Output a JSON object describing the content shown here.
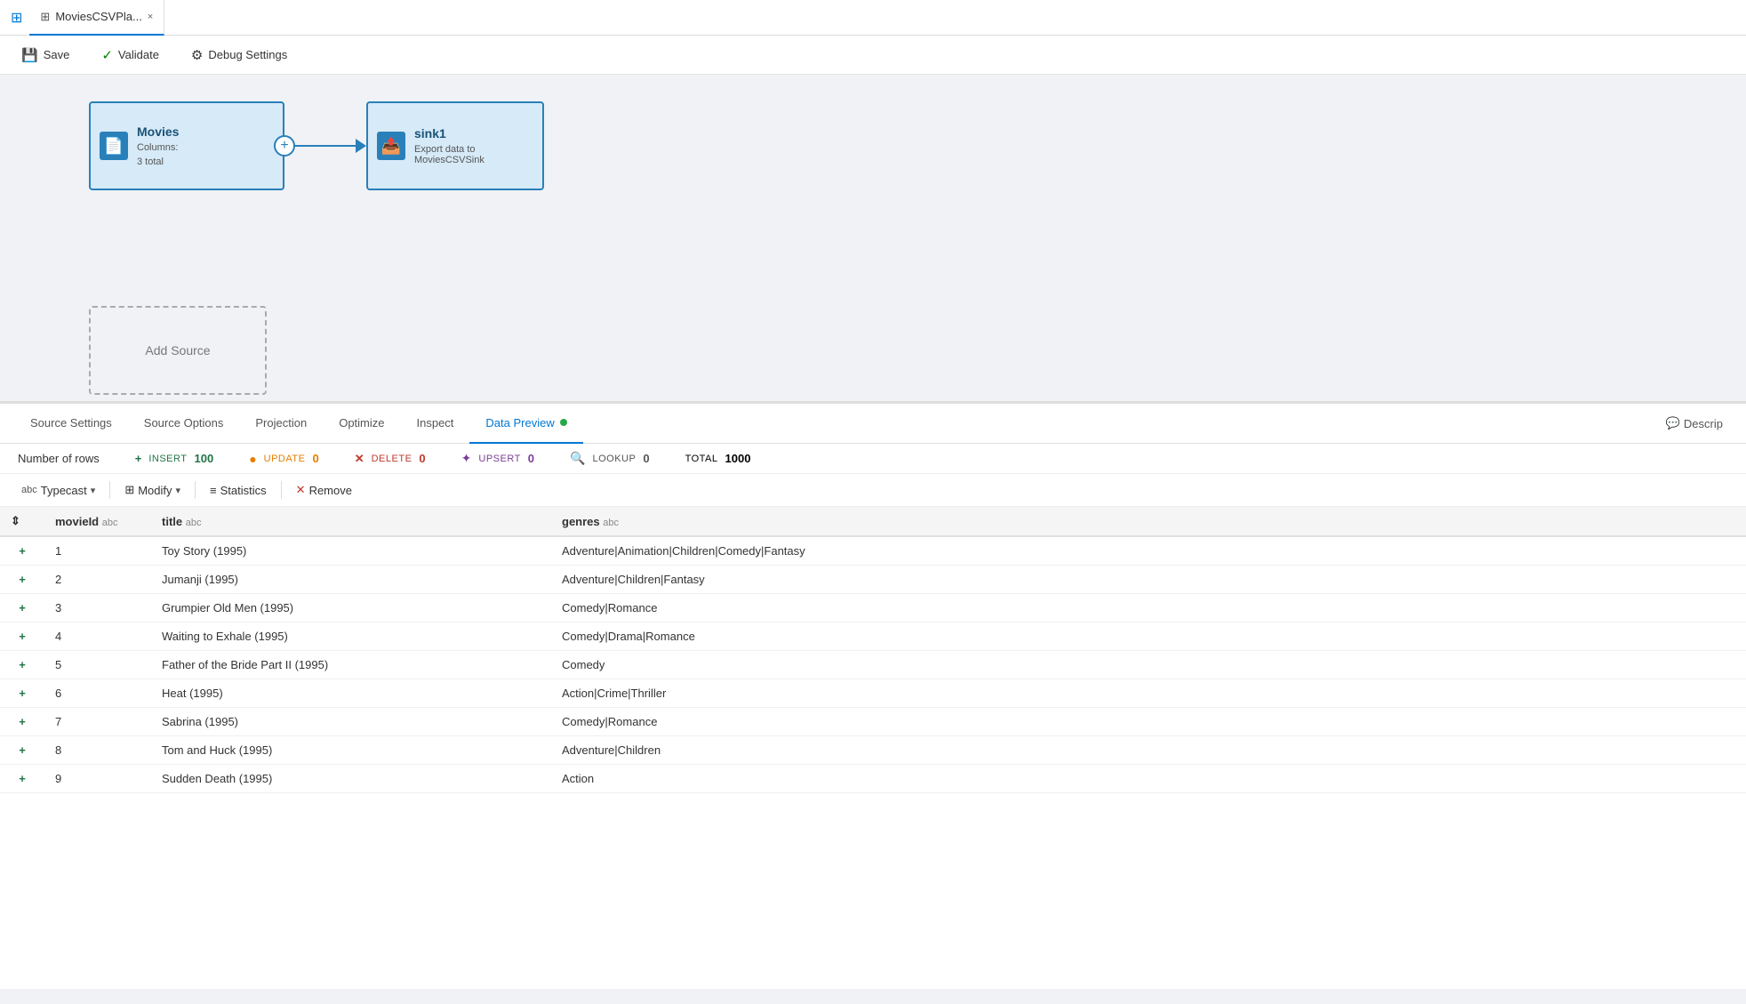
{
  "titleBar": {
    "tabTitle": "MoviesCSVPla...",
    "closeLabel": "×"
  },
  "toolbar": {
    "saveLabel": "Save",
    "validateLabel": "Validate",
    "debugLabel": "Debug Settings"
  },
  "canvas": {
    "sourceNode": {
      "title": "Movies",
      "columnsLabel": "Columns:",
      "columnsValue": "3 total"
    },
    "sinkNode": {
      "title": "sink1",
      "description": "Export data to MoviesCSVSink"
    },
    "addSourceLabel": "Add Source"
  },
  "tabs": {
    "items": [
      {
        "label": "Source Settings",
        "active": false
      },
      {
        "label": "Source Options",
        "active": false
      },
      {
        "label": "Projection",
        "active": false
      },
      {
        "label": "Optimize",
        "active": false
      },
      {
        "label": "Inspect",
        "active": false
      },
      {
        "label": "Data Preview",
        "active": true
      }
    ],
    "describeLabel": "Descrip"
  },
  "statsBar": {
    "rowsLabel": "Number of rows",
    "insert": {
      "label": "INSERT",
      "value": "100"
    },
    "update": {
      "label": "UPDATE",
      "value": "0"
    },
    "delete": {
      "label": "DELETE",
      "value": "0"
    },
    "upsert": {
      "label": "UPSERT",
      "value": "0"
    },
    "lookup": {
      "label": "LOOKUP",
      "value": "0"
    },
    "total": {
      "label": "TOTAL",
      "value": "1000"
    }
  },
  "dataToolbar": {
    "typecastLabel": "abc Typecast",
    "modifyLabel": "Modify",
    "statisticsLabel": "Statistics",
    "removeLabel": "Remove"
  },
  "table": {
    "columns": [
      {
        "id": "action",
        "label": "",
        "type": ""
      },
      {
        "id": "movieId",
        "label": "movieId",
        "type": "abc"
      },
      {
        "id": "title",
        "label": "title",
        "type": "abc"
      },
      {
        "id": "genres",
        "label": "genres",
        "type": "abc"
      }
    ],
    "rows": [
      {
        "action": "+",
        "movieId": "1",
        "title": "Toy Story (1995)",
        "genres": "Adventure|Animation|Children|Comedy|Fantasy"
      },
      {
        "action": "+",
        "movieId": "2",
        "title": "Jumanji (1995)",
        "genres": "Adventure|Children|Fantasy"
      },
      {
        "action": "+",
        "movieId": "3",
        "title": "Grumpier Old Men (1995)",
        "genres": "Comedy|Romance"
      },
      {
        "action": "+",
        "movieId": "4",
        "title": "Waiting to Exhale (1995)",
        "genres": "Comedy|Drama|Romance"
      },
      {
        "action": "+",
        "movieId": "5",
        "title": "Father of the Bride Part II (1995)",
        "genres": "Comedy"
      },
      {
        "action": "+",
        "movieId": "6",
        "title": "Heat (1995)",
        "genres": "Action|Crime|Thriller"
      },
      {
        "action": "+",
        "movieId": "7",
        "title": "Sabrina (1995)",
        "genres": "Comedy|Romance"
      },
      {
        "action": "+",
        "movieId": "8",
        "title": "Tom and Huck (1995)",
        "genres": "Adventure|Children"
      },
      {
        "action": "+",
        "movieId": "9",
        "title": "Sudden Death (1995)",
        "genres": "Action"
      }
    ]
  }
}
